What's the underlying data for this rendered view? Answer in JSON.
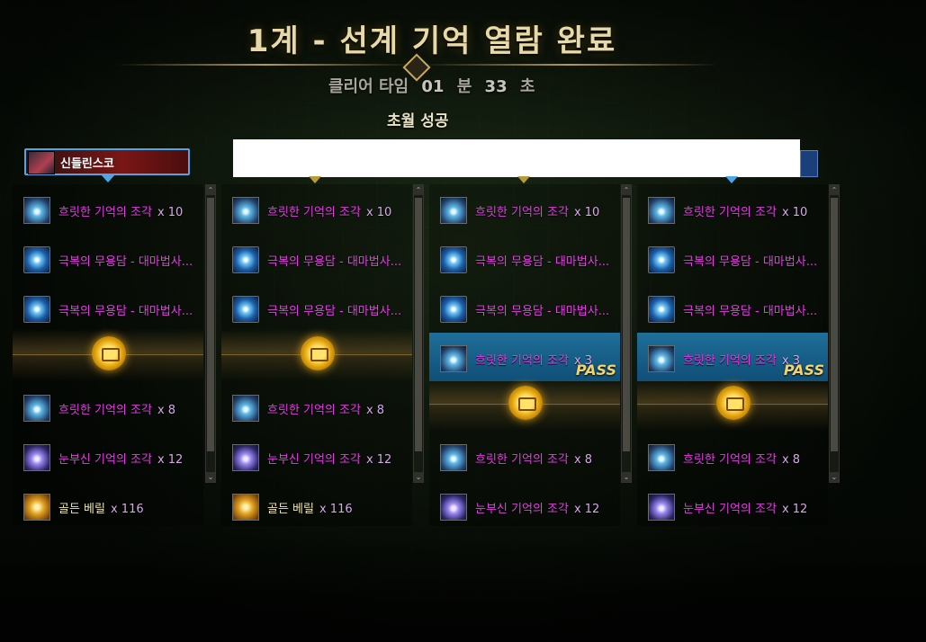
{
  "header": {
    "title": "1계 - 선계 기억 열람 완료",
    "clear_time_label": "클리어 타임",
    "clear_minutes": "01",
    "minute_unit": "분",
    "clear_seconds": "33",
    "second_unit": "초",
    "result": "초월 성공"
  },
  "player": {
    "name": "신들린스코"
  },
  "columns": [
    {
      "items_top": [
        {
          "icon": "memory-fragment-icon",
          "name": "흐릿한 기억의 조각",
          "mult": "x 10"
        },
        {
          "icon": "conquest-token-icon",
          "name": "극복의 무용담 - 대마법사...",
          "mult": ""
        },
        {
          "icon": "conquest-token-icon",
          "name": "극복의 무용담 - 대마법사...",
          "mult": ""
        }
      ],
      "pass": null,
      "items_bottom": [
        {
          "icon": "memory-fragment-icon",
          "name": "흐릿한 기억의 조각",
          "mult": "x 8"
        },
        {
          "icon": "bright-fragment-icon",
          "name": "눈부신 기억의 조각",
          "mult": "x 12"
        },
        {
          "icon": "golden-beryl-icon",
          "name": "골든 베릴",
          "mult": "x 116"
        }
      ]
    },
    {
      "items_top": [
        {
          "icon": "memory-fragment-icon",
          "name": "흐릿한 기억의 조각",
          "mult": "x 10"
        },
        {
          "icon": "conquest-token-icon",
          "name": "극복의 무용담 - 대마법사...",
          "mult": ""
        },
        {
          "icon": "conquest-token-icon",
          "name": "극복의 무용담 - 대마법사...",
          "mult": ""
        }
      ],
      "pass": null,
      "items_bottom": [
        {
          "icon": "memory-fragment-icon",
          "name": "흐릿한 기억의 조각",
          "mult": "x 8"
        },
        {
          "icon": "bright-fragment-icon",
          "name": "눈부신 기억의 조각",
          "mult": "x 12"
        },
        {
          "icon": "golden-beryl-icon",
          "name": "골든 베릴",
          "mult": "x 116"
        }
      ]
    },
    {
      "items_top": [
        {
          "icon": "memory-fragment-icon",
          "name": "흐릿한 기억의 조각",
          "mult": "x 10"
        },
        {
          "icon": "conquest-token-icon",
          "name": "극복의 무용담 - 대마법사...",
          "mult": ""
        },
        {
          "icon": "conquest-token-icon",
          "name": "극복의 무용담 - 대마법사...",
          "mult": ""
        }
      ],
      "pass": {
        "icon": "memory-fragment-icon",
        "name": "흐릿한 기억의 조각",
        "mult": "x 3",
        "badge": "PASS"
      },
      "items_bottom": [
        {
          "icon": "memory-fragment-icon",
          "name": "흐릿한 기억의 조각",
          "mult": "x 8"
        },
        {
          "icon": "bright-fragment-icon",
          "name": "눈부신 기억의 조각",
          "mult": "x 12"
        }
      ]
    },
    {
      "items_top": [
        {
          "icon": "memory-fragment-icon",
          "name": "흐릿한 기억의 조각",
          "mult": "x 10"
        },
        {
          "icon": "conquest-token-icon",
          "name": "극복의 무용담 - 대마법사...",
          "mult": ""
        },
        {
          "icon": "conquest-token-icon",
          "name": "극복의 무용담 - 대마법사...",
          "mult": ""
        }
      ],
      "pass": {
        "icon": "memory-fragment-icon",
        "name": "흐릿한 기억의 조각",
        "mult": "x 3",
        "badge": "PASS"
      },
      "items_bottom": [
        {
          "icon": "memory-fragment-icon",
          "name": "흐릿한 기억의 조각",
          "mult": "x 8"
        },
        {
          "icon": "bright-fragment-icon",
          "name": "눈부신 기억의 조각",
          "mult": "x 12"
        }
      ]
    }
  ],
  "scrollbar": {
    "up_glyph": "⌃",
    "down_glyph": "⌄"
  },
  "colors": {
    "rare_item": "#e63ee6",
    "pass_badge": "#f3d36a",
    "nameplate_border": "#4ea6e6"
  }
}
